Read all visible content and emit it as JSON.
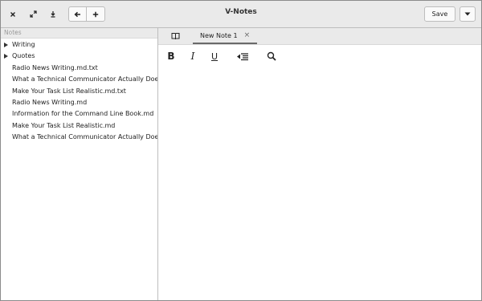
{
  "window": {
    "title": "V-Notes"
  },
  "titlebar": {
    "close_icon": "close-icon",
    "maximize_icon": "maximize-icon",
    "download_icon": "download-icon",
    "back_icon": "back-arrow-icon",
    "add_icon": "plus-icon",
    "save_label": "Save",
    "menu_icon": "chevron-down-icon"
  },
  "sidebar": {
    "header": "Notes",
    "folders": [
      {
        "label": "Writing"
      },
      {
        "label": "Quotes"
      }
    ],
    "items": [
      {
        "label": "Radio News Writing.md.txt"
      },
      {
        "label": "What a Technical Communicator Actually Does"
      },
      {
        "label": "Make Your Task List Realistic.md.txt"
      },
      {
        "label": "Radio News Writing.md"
      },
      {
        "label": "Information for the Command Line Book.md"
      },
      {
        "label": "Make Your Task List Realistic.md"
      },
      {
        "label": "What a Technical Communicator Actually Does"
      }
    ]
  },
  "editor": {
    "tabs": [
      {
        "label": "New Note 1",
        "close": "×"
      }
    ],
    "toolbar": {
      "bold": "B",
      "italic": "I",
      "underline": "U",
      "indent_icon": "outdent-icon",
      "search_icon": "search-icon"
    },
    "content": ""
  }
}
